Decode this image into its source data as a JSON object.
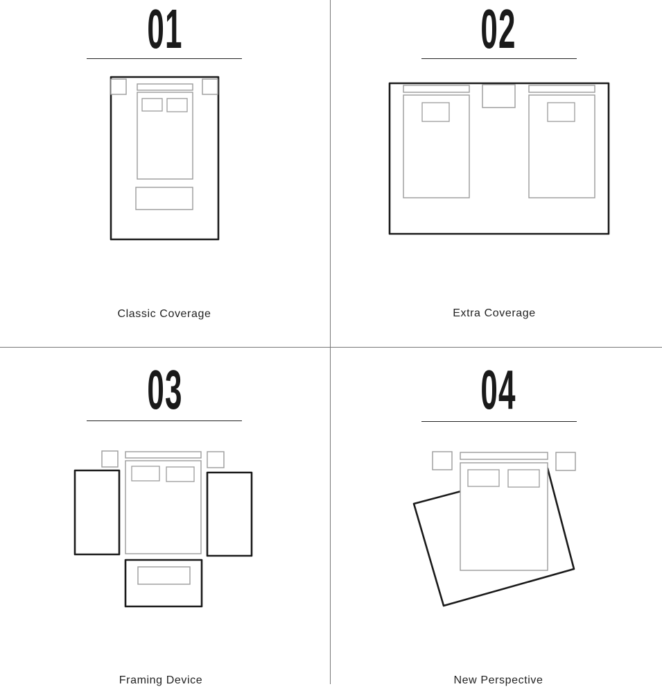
{
  "panels": [
    {
      "number": "01",
      "caption": "Classic Coverage"
    },
    {
      "number": "02",
      "caption": "Extra Coverage"
    },
    {
      "number": "03",
      "caption": "Framing Device"
    },
    {
      "number": "04",
      "caption": "New Perspective"
    }
  ],
  "colors": {
    "rug_outline": "#1a1a1a",
    "furniture_outline": "#9a9a9a",
    "divider": "#777777"
  }
}
